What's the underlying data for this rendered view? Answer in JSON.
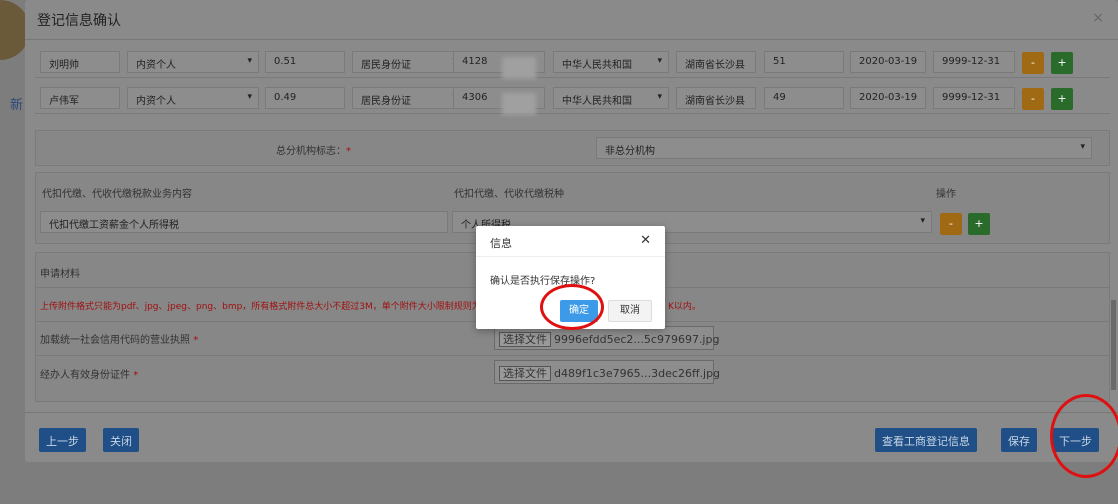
{
  "background": {
    "tab_fragment": "新"
  },
  "modal": {
    "title": "登记信息确认",
    "close": "×",
    "investors": [
      {
        "name": "刘明帅",
        "type": "内资个人",
        "ratio": "0.51",
        "id_type": "居民身份证",
        "id_prefix": "4128",
        "nationality": "中华人民共和国",
        "address": "湖南省长沙县",
        "percent": "51",
        "start": "2020-03-19",
        "end": "9999-12-31"
      },
      {
        "name": "卢伟军",
        "type": "内资个人",
        "ratio": "0.49",
        "id_type": "居民身份证",
        "id_prefix": "4306",
        "nationality": "中华人民共和国",
        "address": "湖南省长沙县",
        "percent": "49",
        "start": "2020-03-19",
        "end": "9999-12-31"
      }
    ],
    "minus": "-",
    "plus": "+",
    "branch_label": "总分机构标志：",
    "required": "*",
    "branch_value": "非总分机构",
    "withhold": {
      "col1": "代扣代缴、代收代缴税款业务内容",
      "col2": "代扣代缴、代收代缴税种",
      "col3": "操作",
      "value1": "代扣代缴工资薪金个人所得税",
      "value2": "个人所得税"
    },
    "materials": {
      "title": "申请材料",
      "notice": "上传附件格式只能为pdf、jpg、jpeg、png、bmp，所有格式附件总大小不超过3M，单个附件大小限制规则为pd",
      "notice_tail": "K以内。",
      "items": [
        {
          "label": "加载统一社会信用代码的营业执照",
          "file_btn": "选择文件",
          "file": "9996efdd5ec2...5c979697.jpg"
        },
        {
          "label": "经办人有效身份证件",
          "file_btn": "选择文件",
          "file": "d489f1c3e7965...3dec26ff.jpg"
        }
      ]
    },
    "footer": {
      "prev": "上一步",
      "close": "关闭",
      "view": "查看工商登记信息",
      "save": "保存",
      "next": "下一步"
    }
  },
  "dialog": {
    "title": "信息",
    "close": "✕",
    "message": "确认是否执行保存操作?",
    "ok": "确定",
    "cancel": "取消"
  }
}
